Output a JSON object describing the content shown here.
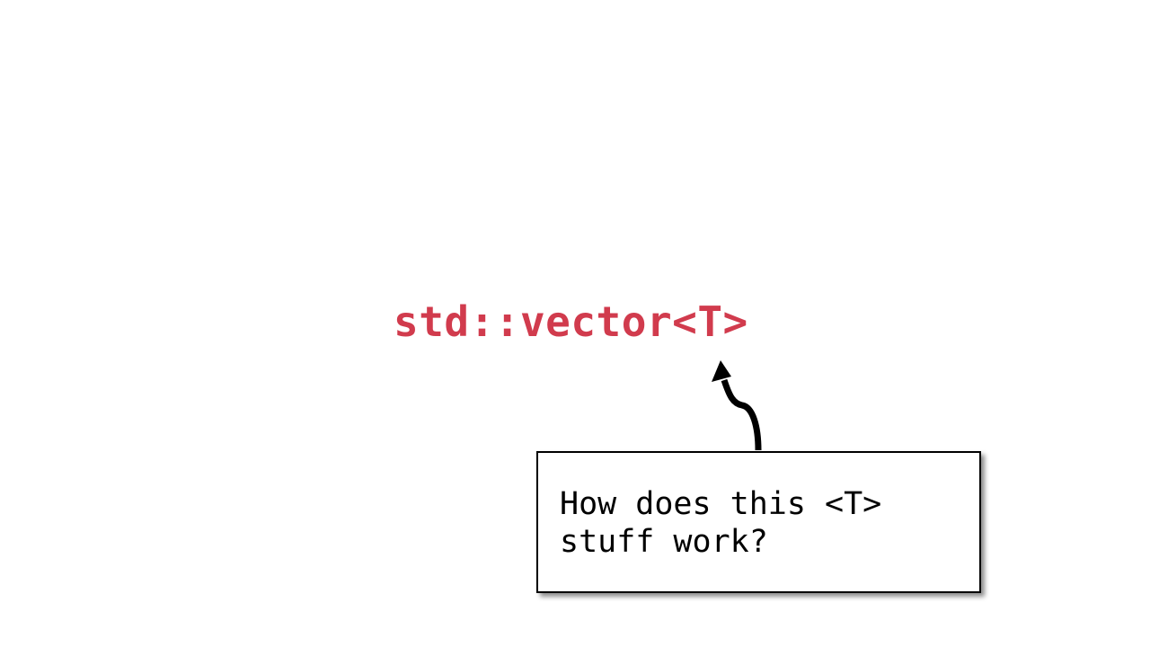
{
  "slide": {
    "code_title": "std::vector<T>",
    "code_color": "#d13b4d",
    "callout": {
      "lines": [
        "How does this <T>",
        "stuff work?"
      ]
    }
  }
}
